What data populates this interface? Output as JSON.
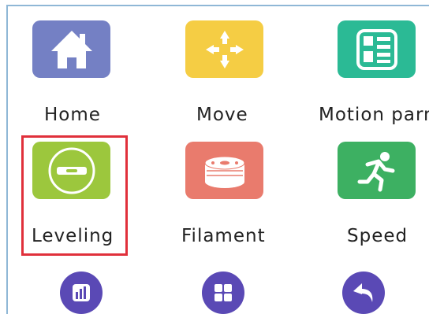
{
  "menu": {
    "items": [
      {
        "label": "Home",
        "icon": "home-icon",
        "color": "#7480c4"
      },
      {
        "label": "Move",
        "icon": "move-arrows-icon",
        "color": "#f5cd44"
      },
      {
        "label": "Motion parm",
        "icon": "motion-params-icon",
        "color": "#2bba95"
      },
      {
        "label": "Leveling",
        "icon": "level-icon",
        "color": "#9cc73d"
      },
      {
        "label": "Filament",
        "icon": "filament-spool-icon",
        "color": "#e97b6d"
      },
      {
        "label": "Speed",
        "icon": "running-person-icon",
        "color": "#3db062"
      }
    ],
    "selected": "Leveling",
    "selection_color": "#e0303b"
  },
  "bottom_buttons": [
    {
      "icon": "bar-chart-icon"
    },
    {
      "icon": "grid-icon"
    },
    {
      "icon": "back-arrow-icon"
    }
  ]
}
